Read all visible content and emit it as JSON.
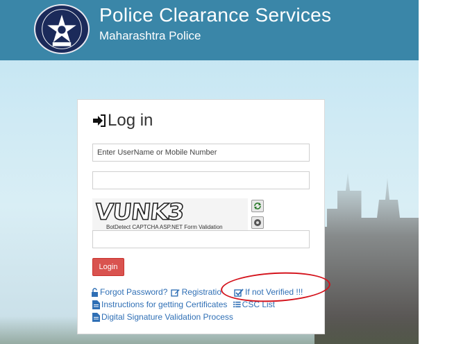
{
  "header": {
    "title": "Police Clearance Services",
    "subtitle": "Maharashtra Police",
    "logo_icon": "maharashtra-police-emblem"
  },
  "login": {
    "heading": "Log in",
    "username_placeholder": "Enter UserName or Mobile Number",
    "username_value": "",
    "password_value": "",
    "captcha_text": "VUNK3",
    "captcha_caption": "BotDetect CAPTCHA ASP.NET Form Validation",
    "captcha_input_value": "",
    "login_button": "Login"
  },
  "links": {
    "forgot_password": "Forgot Password?",
    "registration": "Registratio",
    "if_not_verified": "If not Verified !!!",
    "instructions": "Instructions for getting Certificates",
    "csc_list": "CSC List",
    "digital_signature": "Digital Signature Validation Process"
  },
  "colors": {
    "header_bg": "#3a86a8",
    "link": "#2f6fb5",
    "login_button": "#d9534f",
    "highlight": "#d4121b"
  }
}
